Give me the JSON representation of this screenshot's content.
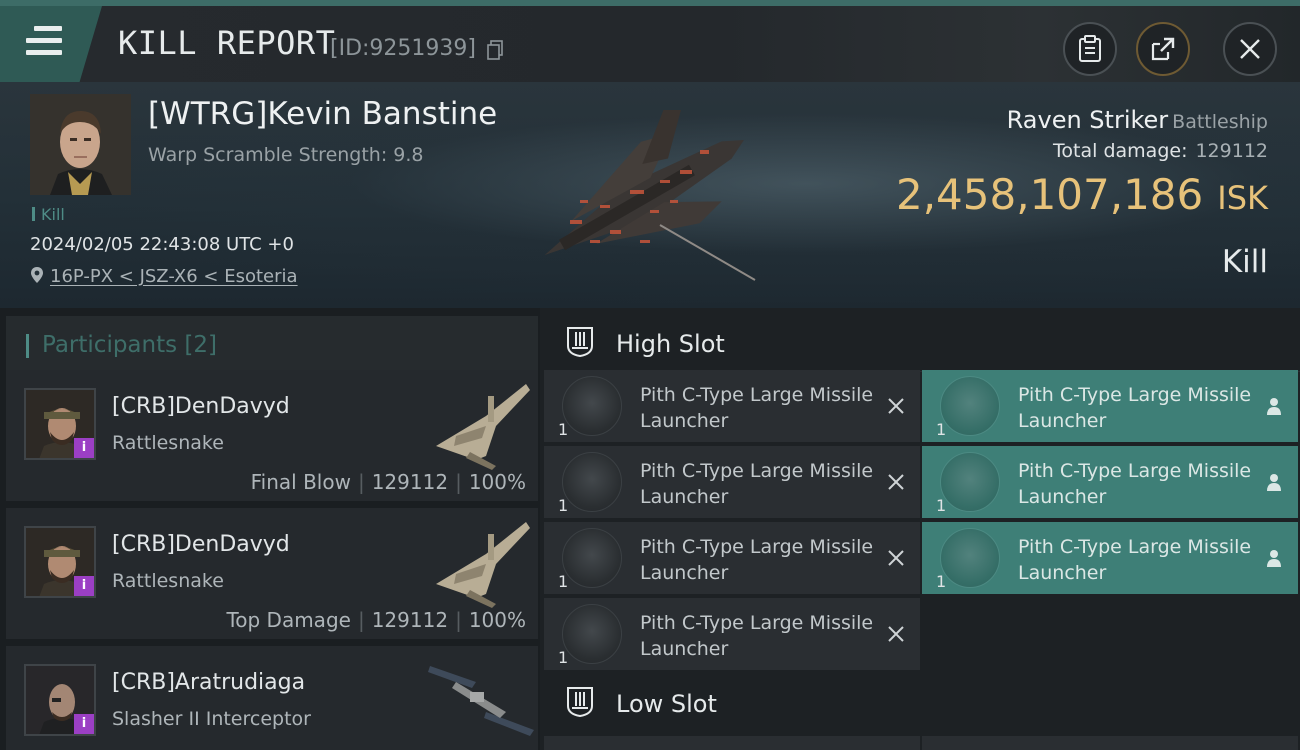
{
  "topbar": {
    "title": "KILL REPORT",
    "report_id": "[ID:9251939]",
    "icons": [
      "menu-icon",
      "copy-icon",
      "clipboard-icon",
      "share-icon",
      "close-icon"
    ]
  },
  "victim": {
    "name": "[WTRG]Kevin Banstine",
    "warp_scramble": "Warp Scramble Strength: 9.8",
    "kill_tag": "Kill",
    "datetime": "2024/02/05 22:43:08 UTC +0",
    "location": "16P-PX < JSZ-X6 < Esoteria",
    "ship_name": "Raven Striker",
    "ship_class": "Battleship",
    "total_damage_label": "Total damage:",
    "total_damage": "129112",
    "isk_value": "2,458,107,186",
    "isk_unit": "ISK",
    "result": "Kill"
  },
  "participants": {
    "label": "Participants [2]",
    "rows": [
      {
        "name": "[CRB]DenDavyd",
        "ship": "Rattlesnake",
        "role": "Final Blow",
        "damage": "129112",
        "percent": "100%"
      },
      {
        "name": "[CRB]DenDavyd",
        "ship": "Rattlesnake",
        "role": "Top Damage",
        "damage": "129112",
        "percent": "100%"
      },
      {
        "name": "[CRB]Aratrudiaga",
        "ship": "Slasher II Interceptor",
        "role": "",
        "damage": "",
        "percent": ""
      }
    ]
  },
  "fitting": {
    "high_slot_label": "High Slot",
    "low_slot_label": "Low Slot",
    "destroyed": [
      {
        "name": "Pith C-Type Large Missile Launcher",
        "qty": "1"
      },
      {
        "name": "Pith C-Type Large Missile Launcher",
        "qty": "1"
      },
      {
        "name": "Pith C-Type Large Missile Launcher",
        "qty": "1"
      },
      {
        "name": "Pith C-Type Large Missile Launcher",
        "qty": "1"
      }
    ],
    "dropped": [
      {
        "name": "Pith C-Type Large Missile Launcher",
        "qty": "1"
      },
      {
        "name": "Pith C-Type Large Missile Launcher",
        "qty": "1"
      },
      {
        "name": "Pith C-Type Large Missile Launcher",
        "qty": "1"
      }
    ]
  },
  "colors": {
    "accent_teal": "#3e7f77",
    "isk_gold": "#e7c27a",
    "badge_purple": "#9b3fc4"
  }
}
